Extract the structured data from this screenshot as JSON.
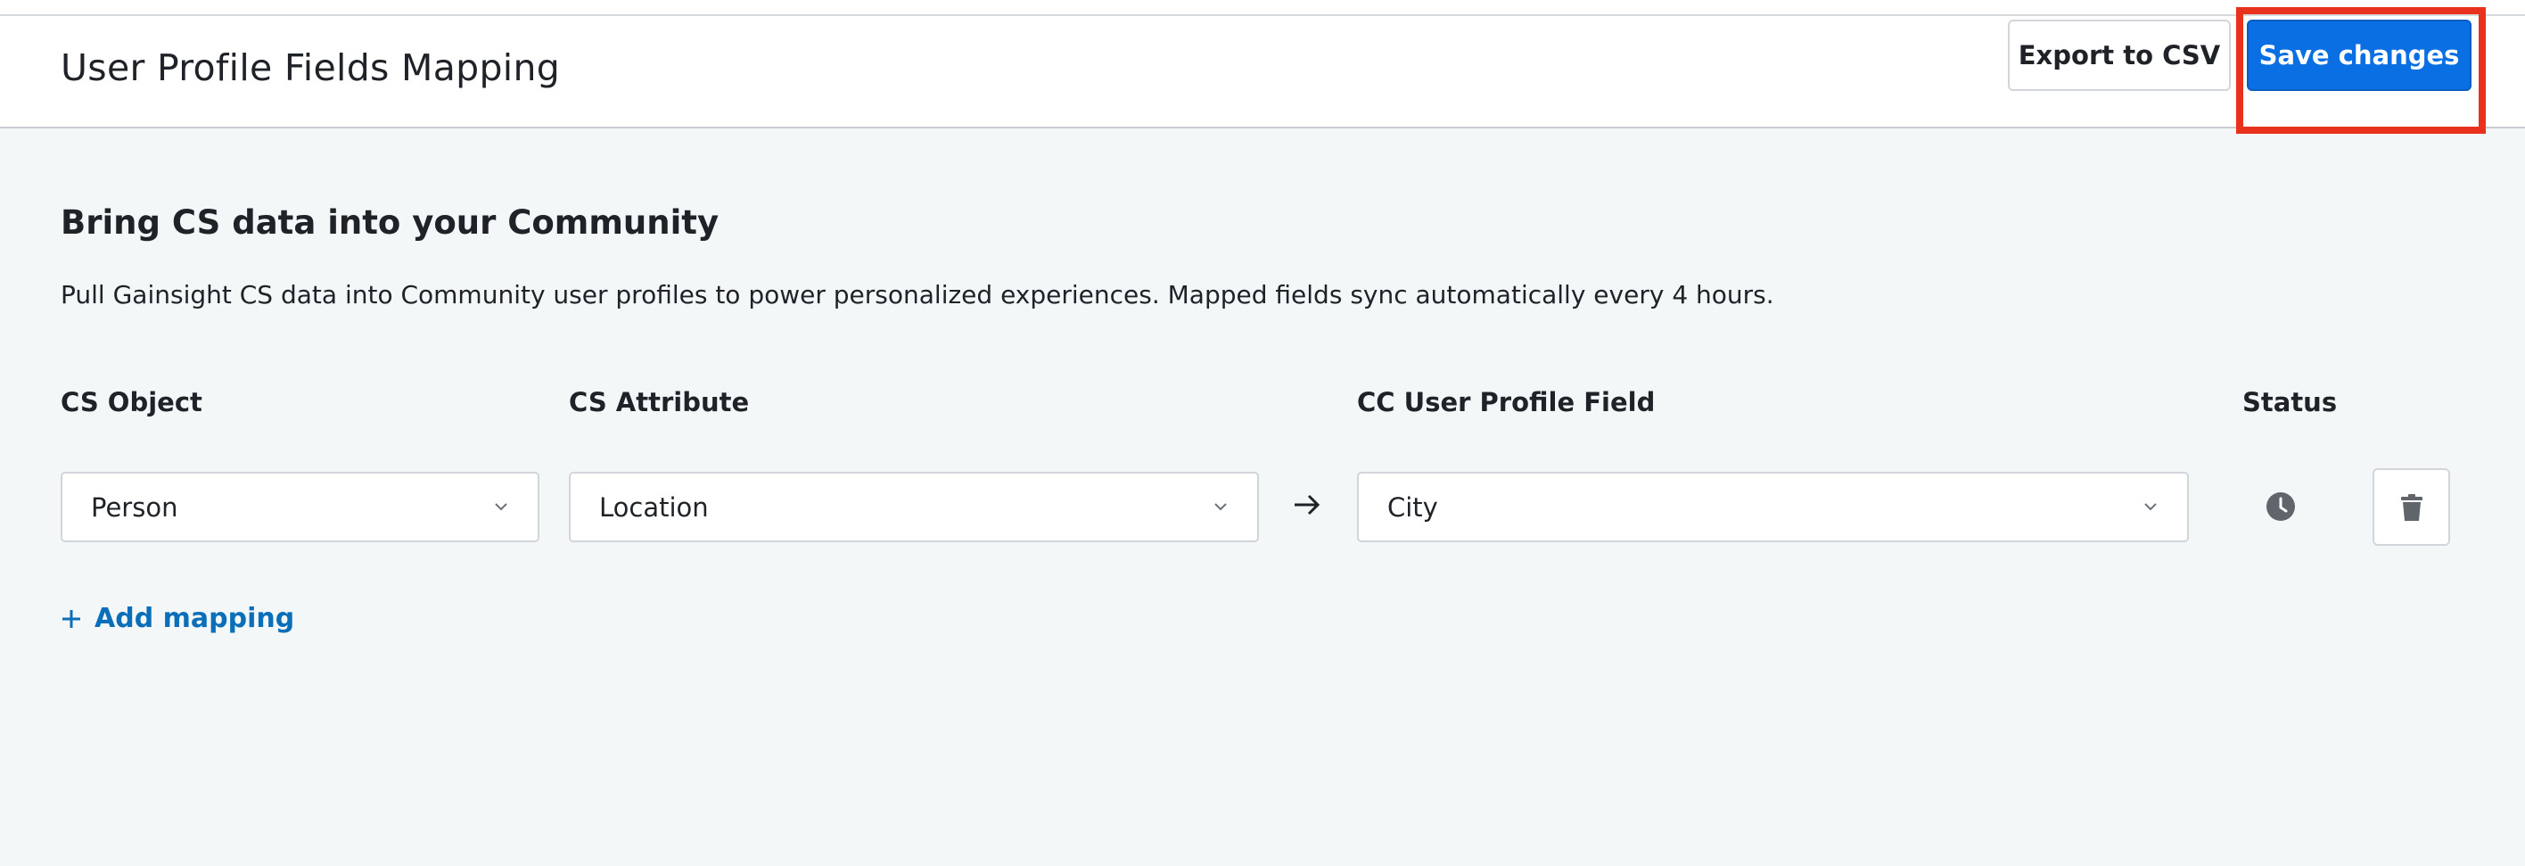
{
  "header": {
    "title": "User Profile Fields Mapping",
    "export_label": "Export to CSV",
    "save_label": "Save changes"
  },
  "section": {
    "title": "Bring CS data into your Community",
    "description": "Pull Gainsight CS data into Community user profiles to power personalized experiences. Mapped fields sync automatically every 4 hours."
  },
  "columns": {
    "cs_object": "CS Object",
    "cs_attribute": "CS Attribute",
    "cc_field": "CC User Profile Field",
    "status": "Status"
  },
  "mappings": [
    {
      "cs_object": "Person",
      "cs_attribute": "Location",
      "cc_field": "City",
      "status_icon": "clock-icon"
    }
  ],
  "add_mapping_label": "Add mapping",
  "colors": {
    "primary": "#0a6fe3",
    "link": "#0a6fb8",
    "highlight": "#e8321e",
    "background": "#f4f7f8"
  }
}
